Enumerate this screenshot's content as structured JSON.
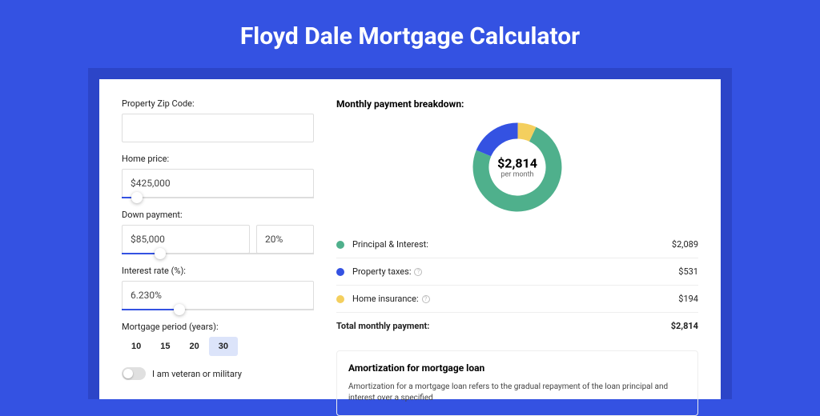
{
  "title": "Floyd Dale Mortgage Calculator",
  "inputs": {
    "zip_label": "Property Zip Code:",
    "zip_value": "",
    "price_label": "Home price:",
    "price_value": "$425,000",
    "down_label": "Down payment:",
    "down_value": "$85,000",
    "down_pct": "20%",
    "rate_label": "Interest rate (%):",
    "rate_value": "6.230%",
    "period_label": "Mortgage period (years):",
    "periods": [
      "10",
      "15",
      "20",
      "30"
    ],
    "period_active": "30",
    "veteran_label": "I am veteran or military"
  },
  "breakdown": {
    "title": "Monthly payment breakdown:",
    "total_amount": "$2,814",
    "total_sub": "per month",
    "items": [
      {
        "label": "Principal & Interest:",
        "value": "$2,089",
        "num": 2089,
        "color": "green"
      },
      {
        "label": "Property taxes:",
        "value": "$531",
        "num": 531,
        "color": "blue",
        "info": true
      },
      {
        "label": "Home insurance:",
        "value": "$194",
        "num": 194,
        "color": "yellow",
        "info": true
      }
    ],
    "total_label": "Total monthly payment:",
    "total_value": "$2,814"
  },
  "amort": {
    "title": "Amortization for mortgage loan",
    "text": "Amortization for a mortgage loan refers to the gradual repayment of the loan principal and interest over a specified"
  },
  "chart_data": {
    "type": "pie",
    "title": "Monthly payment breakdown",
    "series": [
      {
        "name": "Principal & Interest",
        "value": 2089,
        "color": "#4fb08c"
      },
      {
        "name": "Property taxes",
        "value": 531,
        "color": "#3452e2"
      },
      {
        "name": "Home insurance",
        "value": 194,
        "color": "#f4cf5e"
      }
    ],
    "total": 2814,
    "center_label": "$2,814 per month"
  }
}
